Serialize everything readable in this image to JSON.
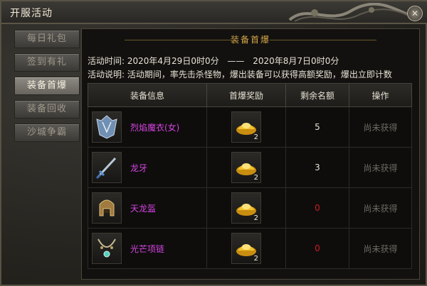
{
  "window": {
    "title": "开服活动"
  },
  "sidebar": {
    "items": [
      {
        "label": "每日礼包",
        "active": false
      },
      {
        "label": "签到有礼",
        "active": false
      },
      {
        "label": "装备首爆",
        "active": true
      },
      {
        "label": "装备回收",
        "active": false
      },
      {
        "label": "沙城争霸",
        "active": false
      }
    ]
  },
  "main": {
    "section_title": "装备首爆",
    "time_label": "活动时间:",
    "time_start": "2020年4月29日0时0分",
    "time_sep": "——",
    "time_end": "2020年8月7日0时0分",
    "desc_label": "活动说明:",
    "desc_text": "活动期间，率先击杀怪物，爆出装备可以获得高额奖励，爆出立即计数",
    "columns": [
      "装备信息",
      "首爆奖励",
      "剩余名额",
      "操作"
    ],
    "rows": [
      {
        "item_name": "烈焰魔衣(女)",
        "item_icon": "robe-icon",
        "reward_icon": "gold-ingot-icon",
        "reward_qty": "2",
        "remaining": "5",
        "status": "尚未获得"
      },
      {
        "item_name": "龙牙",
        "item_icon": "sword-icon",
        "reward_icon": "gold-ingot-icon",
        "reward_qty": "2",
        "remaining": "3",
        "status": "尚未获得"
      },
      {
        "item_name": "天龙盔",
        "item_icon": "helmet-icon",
        "reward_icon": "gold-ingot-icon",
        "reward_qty": "2",
        "remaining": "0",
        "status": "尚未获得"
      },
      {
        "item_name": "光芒项链",
        "item_icon": "necklace-icon",
        "reward_icon": "gold-ingot-icon",
        "reward_qty": "2",
        "remaining": "0",
        "status": "尚未获得"
      }
    ]
  },
  "colors": {
    "item_name": "#d743e2",
    "remaining_zero": "#c81f1f",
    "accent_gold": "#d5a64a"
  }
}
